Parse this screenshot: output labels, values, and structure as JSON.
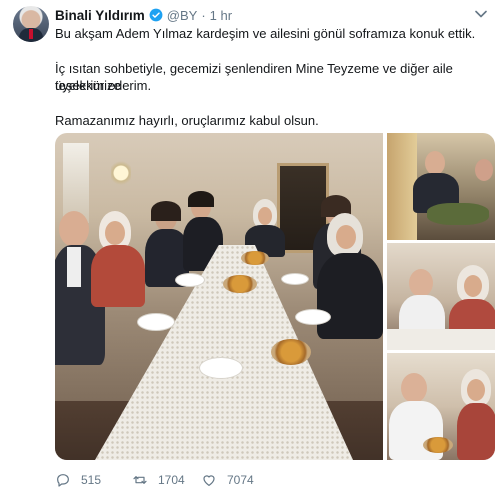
{
  "tweet": {
    "author_name": "Binali Yıldırım",
    "handle": "@BY",
    "separator": "·",
    "time": "1 hr",
    "text_lines": [
      "Bu akşam Adem Yılmaz kardeşim ve ailesini gönül soframıza konuk ettik.",
      "İç ısıtan sohbetiyle, gecemizi şenlendiren Mine Teyzeme ve diğer aile üyelerimize",
      "teşekkür ederim.",
      "Ramazanımız hayırlı, oruçlarımız kabul olsun."
    ],
    "media": {
      "photo_count": 4
    },
    "actions": {
      "replies": "515",
      "retweets": "1704",
      "likes": "7074"
    }
  },
  "colors": {
    "text": "#14171a",
    "secondary": "#657786",
    "verified": "#1da1f2"
  },
  "icons": [
    "verified-badge-icon",
    "chevron-down-icon",
    "reply-icon",
    "retweet-icon",
    "like-icon"
  ]
}
